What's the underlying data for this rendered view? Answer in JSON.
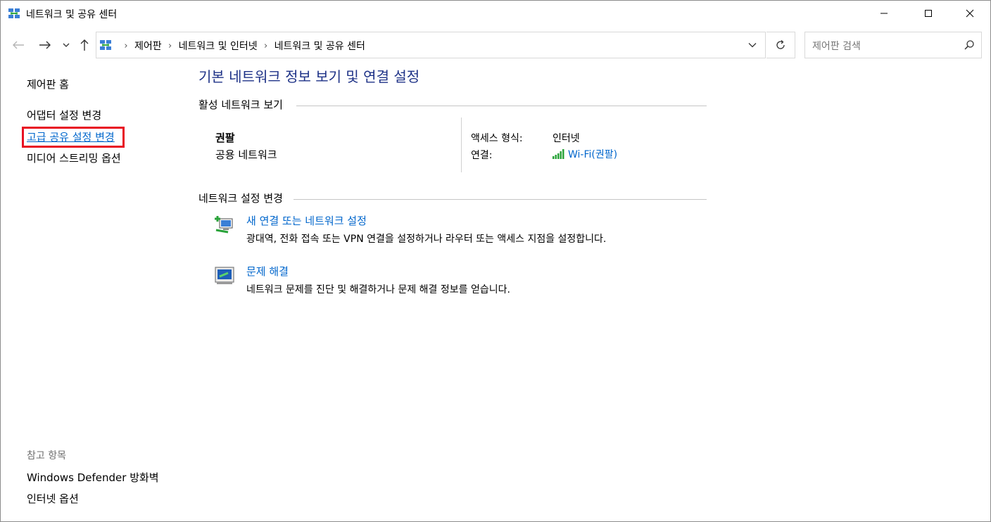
{
  "window": {
    "title": "네트워크 및 공유 센터",
    "controls": [
      "minimize-icon",
      "maximize-icon",
      "close-icon"
    ]
  },
  "navbar": {
    "breadcrumbs": [
      "제어판",
      "네트워크 및 인터넷",
      "네트워크 및 공유 센터"
    ],
    "search_placeholder": "제어판 검색"
  },
  "sidebar": {
    "home": "제어판 홈",
    "links": [
      "어댑터 설정 변경",
      "고급 공유 설정 변경",
      "미디어 스트리밍 옵션"
    ],
    "highlighted_index": 1,
    "see_also_title": "참고 항목",
    "see_also": [
      "Windows Defender 방화벽",
      "인터넷 옵션"
    ]
  },
  "main": {
    "title": "기본 네트워크 정보 보기 및 연결 설정",
    "active_section": "활성 네트워크 보기",
    "network": {
      "name": "권팔",
      "category": "공용 네트워크",
      "access_label": "액세스 형식:",
      "access_value": "인터넷",
      "connection_label": "연결:",
      "connection_value": "Wi-Fi(권팔)"
    },
    "change_section": "네트워크 설정 변경",
    "tasks": [
      {
        "title": "새 연결 또는 네트워크 설정",
        "desc": "광대역, 전화 접속 또는 VPN 연결을 설정하거나 라우터 또는 액세스 지점을 설정합니다.",
        "icon": "new-connection-icon"
      },
      {
        "title": "문제 해결",
        "desc": "네트워크 문제를 진단 및 해결하거나 문제 해결 정보를 얻습니다.",
        "icon": "troubleshoot-icon"
      }
    ]
  },
  "colors": {
    "title_blue": "#1e3287",
    "link_blue": "#0066cc",
    "highlight_red": "#e81123",
    "signal_green": "#2aa33a"
  }
}
